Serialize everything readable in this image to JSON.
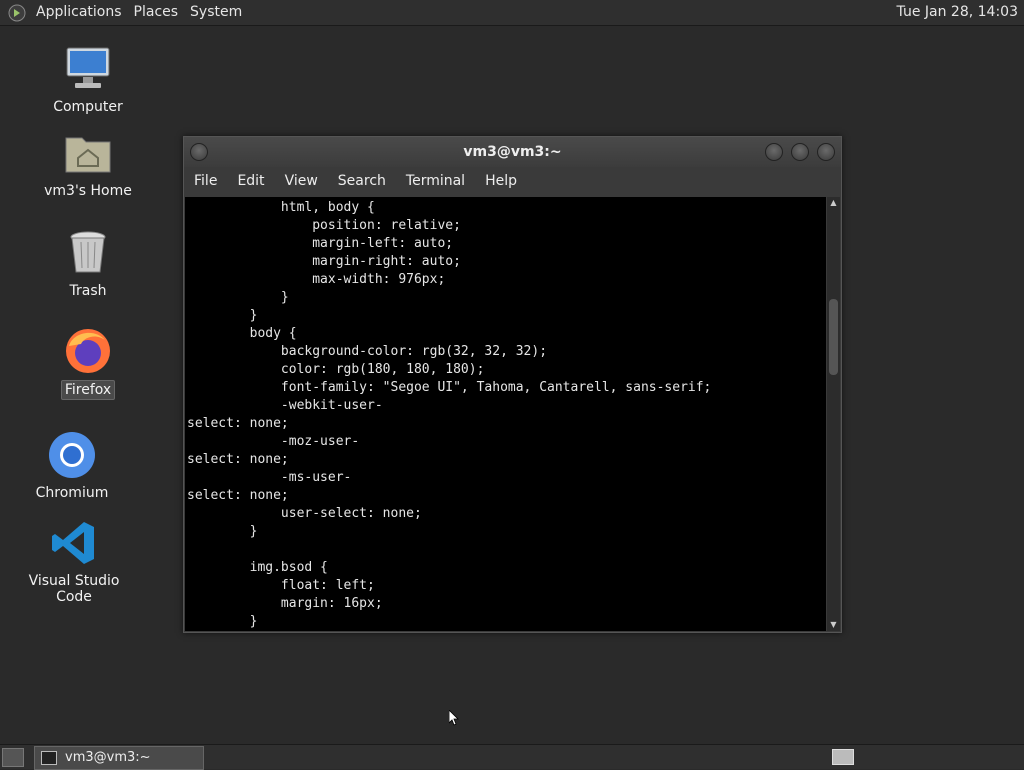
{
  "top_panel": {
    "menus": [
      "Applications",
      "Places",
      "System"
    ],
    "clock": "Tue Jan 28, 14:03"
  },
  "desktop_icons": [
    {
      "label": "Computer",
      "icon": "computer-icon"
    },
    {
      "label": "vm3's Home",
      "icon": "home-folder-icon"
    },
    {
      "label": "Trash",
      "icon": "trash-icon"
    },
    {
      "label": "Firefox",
      "icon": "firefox-icon",
      "selected": true
    },
    {
      "label": "Chromium",
      "icon": "chromium-icon"
    },
    {
      "label": "Visual Studio Code",
      "icon": "vscode-icon"
    }
  ],
  "terminal": {
    "title": "vm3@vm3:~",
    "menu": [
      "File",
      "Edit",
      "View",
      "Search",
      "Terminal",
      "Help"
    ],
    "content": "            html, body {\n                position: relative;\n                margin-left: auto;\n                margin-right: auto;\n                max-width: 976px;\n            }\n        }\n        body {\n            background-color: rgb(32, 32, 32);\n            color: rgb(180, 180, 180);\n            font-family: \"Segoe UI\", Tahoma, Cantarell, sans-serif;\n            -webkit-user-\nselect: none;\n            -moz-user-\nselect: none;\n            -ms-user-\nselect: none;\n            user-select: none;\n        }\n\n        img.bsod {\n            float: left;\n            margin: 16px;\n        }"
  },
  "bottom_panel": {
    "task_label": "vm3@vm3:~"
  }
}
